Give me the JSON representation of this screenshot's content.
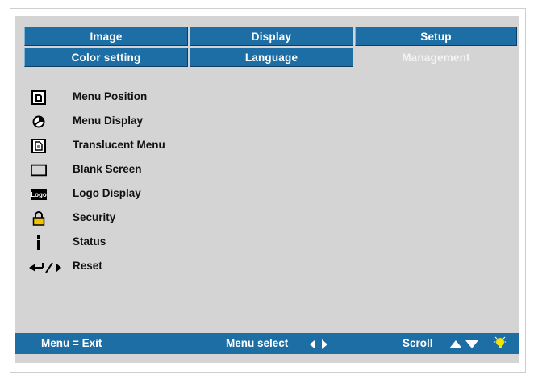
{
  "tabs": {
    "row1": [
      "Image",
      "Display",
      "Setup"
    ],
    "row2": [
      "Color setting",
      "Language",
      "Management"
    ],
    "active": "Management"
  },
  "menu": {
    "items": [
      {
        "label": "Menu Position",
        "icon": "menu-position-icon"
      },
      {
        "label": "Menu Display",
        "icon": "timer-icon"
      },
      {
        "label": "Translucent Menu",
        "icon": "translucent-icon"
      },
      {
        "label": "Blank Screen",
        "icon": "blank-screen-icon"
      },
      {
        "label": "Logo Display",
        "icon": "logo-icon",
        "icon_text": "Logo"
      },
      {
        "label": "Security",
        "icon": "lock-icon"
      },
      {
        "label": "Status",
        "icon": "info-icon"
      },
      {
        "label": "Reset",
        "icon": "reset-icon"
      }
    ]
  },
  "statusbar": {
    "exit": "Menu = Exit",
    "select": "Menu select",
    "scroll": "Scroll"
  },
  "colors": {
    "accent": "#1c6ea4",
    "panel": "#d4d4d4",
    "lock": "#f2c200",
    "bulb": "#f5e400"
  }
}
